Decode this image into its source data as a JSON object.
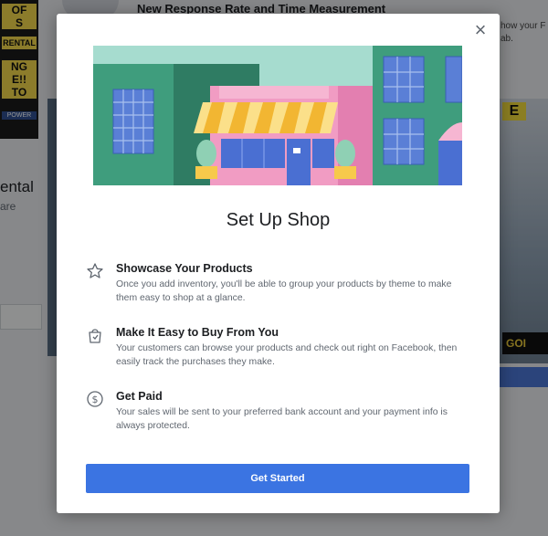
{
  "background": {
    "header_title": "New Response Rate and Time Measurement",
    "right_snippet": [
      "how your F",
      "ab."
    ],
    "left_heading": "ental",
    "left_subtext": "are",
    "poster_lines": [
      "OF",
      "S",
      "RENTAL",
      "NG",
      "E!!",
      "TO",
      "POWER"
    ],
    "photo_sign": "E",
    "photo_sign2": "GOI"
  },
  "modal": {
    "close_label": "×",
    "title": "Set Up Shop",
    "features": [
      {
        "icon": "star-icon",
        "heading": "Showcase Your Products",
        "description": "Once you add inventory, you'll be able to group your products by theme to make them easy to shop at a glance."
      },
      {
        "icon": "shopping-bag-icon",
        "heading": "Make It Easy to Buy From You",
        "description": "Your customers can browse your products and check out right on Facebook, then easily track the purchases they make."
      },
      {
        "icon": "dollar-circle-icon",
        "heading": "Get Paid",
        "description": "Your sales will be sent to your preferred bank account and your payment info is always protected."
      }
    ],
    "cta_label": "Get Started"
  },
  "colors": {
    "primary_button": "#3b74e2",
    "illustration_sky": "#a6dccf",
    "storefront_pink": "#f19cc3",
    "building_green": "#3f9d7d",
    "awning_yellow": "#f7c94b"
  }
}
